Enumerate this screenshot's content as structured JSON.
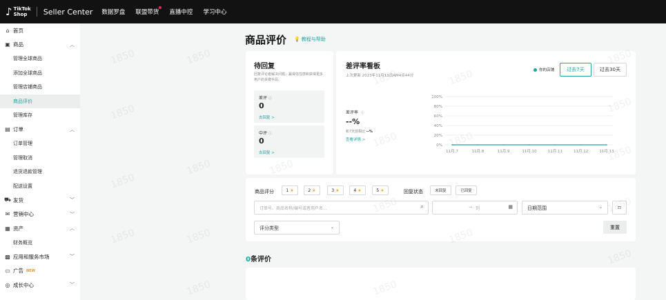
{
  "topbar": {
    "logo_icon": "tiktok-note-icon",
    "logo_line1": "TikTok",
    "logo_line2": "Shop",
    "brand": "Seller Center",
    "nav": [
      "数据罗盘",
      "联盟带货",
      "直播中控",
      "学习中心"
    ]
  },
  "sidebar": {
    "items": [
      {
        "label": "首页",
        "icon": "⌂",
        "icon_name": "home-icon",
        "type": "top"
      },
      {
        "label": "商品",
        "icon": "▣",
        "icon_name": "product-icon",
        "type": "top",
        "chevron": "^"
      },
      {
        "label": "管理全球商品",
        "type": "sub"
      },
      {
        "label": "添加全球商品",
        "type": "sub"
      },
      {
        "label": "管理店铺商品",
        "type": "sub"
      },
      {
        "label": "商品评价",
        "type": "sub",
        "active": true
      },
      {
        "label": "管理库存",
        "type": "sub"
      },
      {
        "label": "订单",
        "icon": "▤",
        "icon_name": "order-icon",
        "type": "top",
        "chevron": "^"
      },
      {
        "label": "订单管理",
        "type": "sub"
      },
      {
        "label": "管理取消",
        "type": "sub"
      },
      {
        "label": "退货退款管理",
        "type": "sub"
      },
      {
        "label": "配送设置",
        "type": "sub"
      },
      {
        "label": "发货",
        "icon": "⛟",
        "icon_name": "shipping-icon",
        "type": "top",
        "chevron": "v"
      },
      {
        "label": "营销中心",
        "icon": "✉",
        "icon_name": "marketing-icon",
        "type": "top",
        "chevron": "v"
      },
      {
        "label": "资产",
        "icon": "▦",
        "icon_name": "assets-icon",
        "type": "top",
        "chevron": "^"
      },
      {
        "label": "财务概览",
        "type": "sub"
      },
      {
        "label": "应用和服务市场",
        "icon": "▩",
        "icon_name": "apps-icon",
        "type": "top",
        "chevron": "v"
      },
      {
        "label": "广告",
        "icon": "▭",
        "icon_name": "ads-icon",
        "type": "top",
        "badge": "NEW"
      },
      {
        "label": "成长中心",
        "icon": "◎",
        "icon_name": "growth-icon",
        "type": "top",
        "chevron": "v"
      }
    ]
  },
  "page": {
    "title": "商品评价",
    "help": "教程与帮助"
  },
  "pending": {
    "title": "待回复",
    "desc": "回复评论者解决问题，赢得信任感和获得更多用户的关键手段。",
    "boxes": [
      {
        "label": "差评",
        "value": "0",
        "link": "去回复 >"
      },
      {
        "label": "中评",
        "value": "0",
        "link": "去回复 >"
      }
    ]
  },
  "rate_board": {
    "title": "差评率看板",
    "updated": "上次更新 2023年11月13日AM4点44分",
    "legend": "你的店铺",
    "ranges": [
      "过去7天",
      "过去30天"
    ],
    "metric_label": "差评率",
    "metric_value": "--%",
    "compare_prefix": "和7天前相比",
    "compare_value": "--%",
    "detail_link": "查看详情 >"
  },
  "chart_data": {
    "type": "line",
    "categories": [
      "11月.7",
      "11月.8",
      "11月.9",
      "11月.10",
      "11月.11",
      "11月.12",
      "11月.13"
    ],
    "series": [
      {
        "name": "你的店铺",
        "values": [
          0,
          0,
          0,
          0,
          0,
          0,
          0
        ],
        "color": "#1ba6a0"
      }
    ],
    "y_ticks": [
      "0%",
      "20%",
      "40%",
      "60%",
      "80%",
      "100%"
    ],
    "ylim": [
      0,
      100
    ],
    "grid": true
  },
  "filters": {
    "rating_label": "商品评分",
    "ratings": [
      "1",
      "2",
      "3",
      "4",
      "5"
    ],
    "reply_label": "回复状态",
    "reply_options": [
      "未回复",
      "已回复"
    ],
    "search_placeholder": "订单号、商品名称/编号或者用户名...",
    "date_separator": "→",
    "date_end_placeholder": "到",
    "date_range_label": "日期范围",
    "type_label": "评分类型",
    "reset": "重置"
  },
  "list": {
    "count": "0",
    "count_suffix": "条评价"
  },
  "watermark": "1850"
}
